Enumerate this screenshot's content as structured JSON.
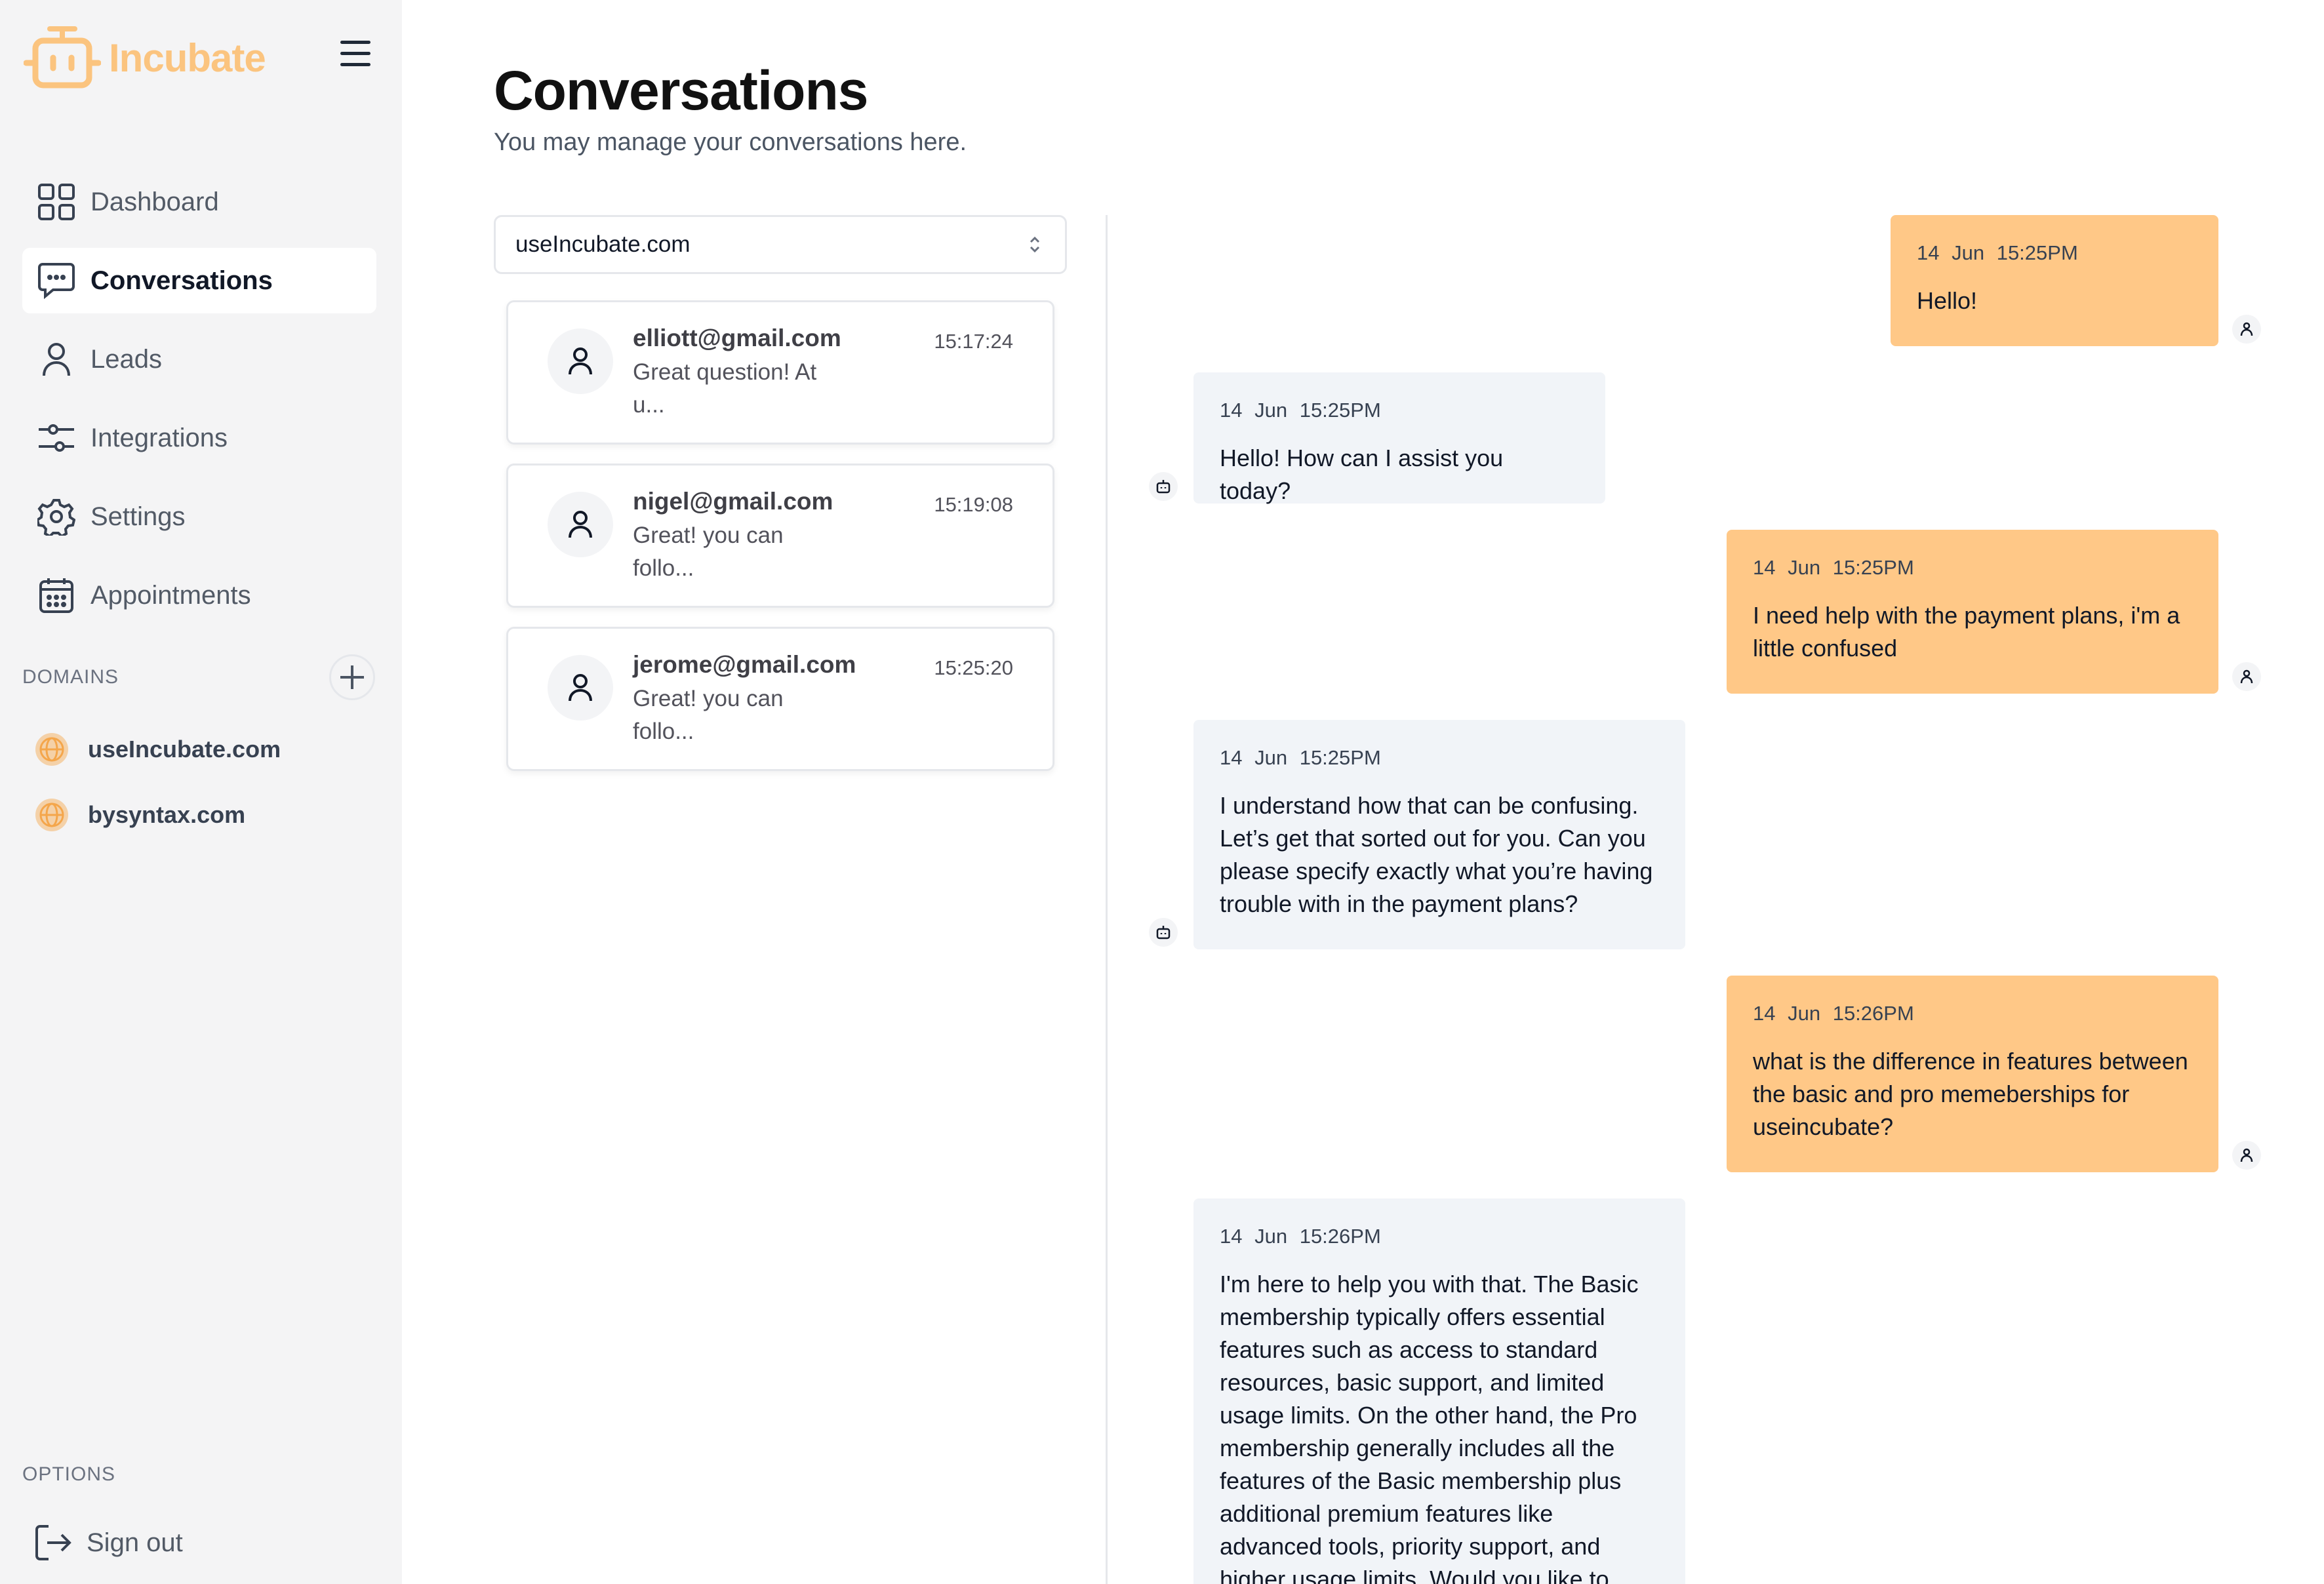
{
  "app": {
    "name": "Incubate"
  },
  "sidebar": {
    "nav": [
      {
        "label": "Dashboard",
        "icon": "dashboard-icon"
      },
      {
        "label": "Conversations",
        "icon": "chat-icon",
        "active": true
      },
      {
        "label": "Leads",
        "icon": "user-icon"
      },
      {
        "label": "Integrations",
        "icon": "sliders-icon"
      },
      {
        "label": "Settings",
        "icon": "gear-icon"
      },
      {
        "label": "Appointments",
        "icon": "calendar-icon"
      }
    ],
    "domains_label": "DOMAINS",
    "domains": [
      {
        "label": "useIncubate.com",
        "icon": "globe-icon"
      },
      {
        "label": "bysyntax.com",
        "icon": "globe-icon"
      }
    ],
    "options_label": "OPTIONS",
    "signout_label": "Sign out"
  },
  "main": {
    "title": "Conversations",
    "subtitle": "You may manage your conversations here.",
    "selected_domain": "useIncubate.com",
    "conversations": [
      {
        "email": "elliott@gmail.com",
        "preview": "Great question! At u...",
        "time": "15:17:24"
      },
      {
        "email": "nigel@gmail.com",
        "preview": "Great! you can follo...",
        "time": "15:19:08"
      },
      {
        "email": "jerome@gmail.com",
        "preview": "Great! you can follo...",
        "time": "15:25:20"
      }
    ],
    "messages": [
      {
        "role": "user",
        "date": "14 Jun",
        "time": "15:25PM",
        "text": "Hello!"
      },
      {
        "role": "bot",
        "date": "14 Jun",
        "time": "15:25PM",
        "text": "Hello! How can I assist you today?"
      },
      {
        "role": "user",
        "date": "14 Jun",
        "time": "15:25PM",
        "text": "I need help with the payment plans, i'm a little confused"
      },
      {
        "role": "bot",
        "date": "14 Jun",
        "time": "15:25PM",
        "text": "I understand how that can be confusing. Let’s get that sorted out for you. Can you please specify exactly what you’re having trouble with in the payment plans?"
      },
      {
        "role": "user",
        "date": "14 Jun",
        "time": "15:26PM",
        "text": "what is the difference in features between the basic and pro memeberships for useincubate?"
      },
      {
        "role": "bot",
        "date": "14 Jun",
        "time": "15:26PM",
        "text": "I'm here to help you with that. The Basic membership typically offers essential features such as access to standard resources, basic support, and limited usage limits. On the other hand, the Pro membership generally includes all the features of the Basic membership plus additional premium features like advanced tools, priority support, and higher usage limits. Would you like to"
      }
    ]
  },
  "colors": {
    "brand": "#fbc47f",
    "user_bubble": "#ffc887",
    "bot_bubble": "#f1f4f8",
    "sidebar_bg": "#f4f4f5",
    "globe": "#f4a64b"
  }
}
